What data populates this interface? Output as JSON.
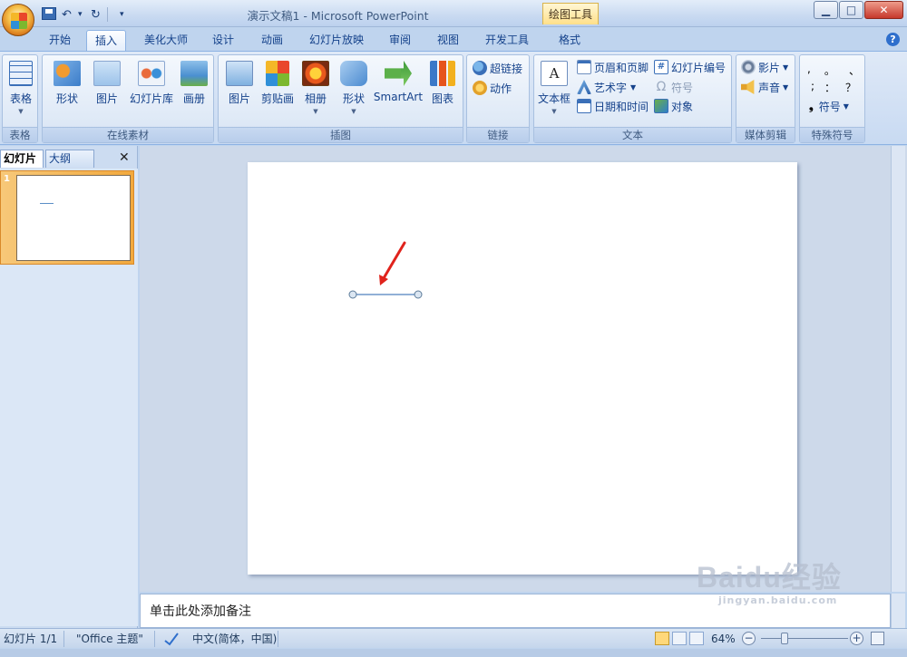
{
  "titlebar": {
    "title": "演示文稿1 - Microsoft PowerPoint",
    "context_tab": "绘图工具",
    "undo_glyph": "↶",
    "redo_glyph": "↻",
    "dropdown_glyph": "▾"
  },
  "tabs": [
    "开始",
    "插入",
    "美化大师",
    "设计",
    "动画",
    "幻灯片放映",
    "审阅",
    "视图",
    "开发工具",
    "格式"
  ],
  "active_tab": "插入",
  "ribbon": {
    "table": {
      "button": "表格",
      "group": "表格"
    },
    "online": {
      "buttons": [
        "形状",
        "图片",
        "幻灯片库",
        "画册"
      ],
      "group": "在线素材"
    },
    "illustrations": {
      "buttons": [
        "图片",
        "剪贴画",
        "相册",
        "形状",
        "SmartArt",
        "图表"
      ],
      "group": "插图"
    },
    "links": {
      "hyperlink": "超链接",
      "action": "动作",
      "group": "链接"
    },
    "text": {
      "textbox": "文本框",
      "header_footer": "页眉和页脚",
      "wordart": "艺术字",
      "datetime": "日期和时间",
      "slide_number": "幻灯片编号",
      "symbol": "符号",
      "object": "对象",
      "group": "文本"
    },
    "media": {
      "movie": "影片",
      "sound": "声音",
      "group": "媒体剪辑"
    },
    "special": {
      "row1": [
        ",",
        "。",
        "、"
      ],
      "row2": [
        ";",
        "：",
        "？"
      ],
      "symbol": "符号",
      "group": "特殊符号"
    }
  },
  "left_panel": {
    "tab_slides": "幻灯片",
    "tab_outline": "大纲",
    "close_glyph": "✕",
    "slide_number": "1"
  },
  "notes_placeholder": "单击此处添加备注",
  "statusbar": {
    "slide_info": "幻灯片 1/1",
    "theme": "\"Office 主题\"",
    "language": "中文(简体，中国)",
    "zoom": "64%"
  },
  "watermark": {
    "logo": "Baidu经验",
    "url": "jingyan.baidu.com"
  },
  "colors": {
    "accent": "#15428b",
    "connector": "#4f81bd",
    "arrow": "#e0231c"
  }
}
